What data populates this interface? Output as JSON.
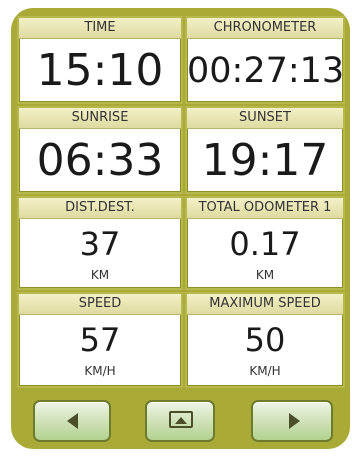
{
  "panels": {
    "time": {
      "label": "TIME",
      "value": "15:10"
    },
    "chronometer": {
      "label": "CHRONOMETER",
      "value": "00:27:13"
    },
    "sunrise": {
      "label": "SUNRISE",
      "value": "06:33"
    },
    "sunset": {
      "label": "SUNSET",
      "value": "19:17"
    },
    "dist_dest": {
      "label": "DIST.DEST.",
      "value": "37",
      "unit": "KM"
    },
    "total_odometer": {
      "label": "TOTAL ODOMETER 1",
      "value": "0.17",
      "unit": "KM"
    },
    "speed": {
      "label": "SPEED",
      "value": "57",
      "unit": "KM/H"
    },
    "max_speed": {
      "label": "MAXIMUM SPEED",
      "value": "50",
      "unit": "KM/H"
    }
  },
  "nav": {
    "prev_icon": "triangle-left-icon",
    "screen_icon": "screen-image-icon",
    "next_icon": "triangle-right-icon"
  },
  "colors": {
    "frame": "#a9ab36",
    "header": "#e8e4b4",
    "button": "#cfe2b8"
  }
}
